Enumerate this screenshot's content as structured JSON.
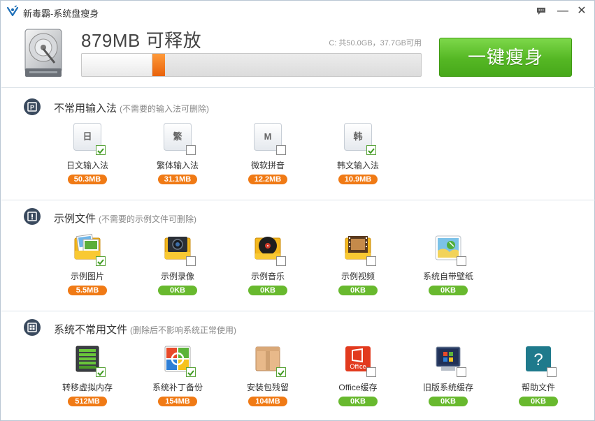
{
  "window": {
    "title": "新毒霸-系统盘瘦身"
  },
  "titlebar": {
    "feedback_icon": "chat-bubble-icon",
    "minimize_label": "—",
    "close_label": "✕"
  },
  "header": {
    "reclaim_text": "879MB 可释放",
    "disk_info": "C: 共50.0GB，37.7GB可用",
    "progress_used_fraction": 0.245,
    "slim_button_label": "一键瘦身",
    "accent_color": "#f07a15",
    "button_color": "#55b724"
  },
  "sections": [
    {
      "title": "不常用输入法",
      "hint": "(不需要的输入法可删除)",
      "items": [
        {
          "label": "日文输入法",
          "size": "50.3MB",
          "checked": true,
          "glyph": "日"
        },
        {
          "label": "繁体输入法",
          "size": "31.1MB",
          "checked": false,
          "glyph": "繁"
        },
        {
          "label": "微软拼音",
          "size": "12.2MB",
          "checked": false,
          "glyph": "M"
        },
        {
          "label": "韩文输入法",
          "size": "10.9MB",
          "checked": true,
          "glyph": "韩"
        }
      ]
    },
    {
      "title": "示例文件",
      "hint": "(不需要的示例文件可删除)",
      "items": [
        {
          "label": "示例图片",
          "size": "5.5MB",
          "checked": true
        },
        {
          "label": "示例录像",
          "size": "0KB",
          "checked": false
        },
        {
          "label": "示例音乐",
          "size": "0KB",
          "checked": false
        },
        {
          "label": "示例视频",
          "size": "0KB",
          "checked": false
        },
        {
          "label": "系统自带壁纸",
          "size": "0KB",
          "checked": false
        }
      ]
    },
    {
      "title": "系统不常用文件",
      "hint": "(删除后不影响系统正常使用)",
      "items": [
        {
          "label": "转移虚拟内存",
          "size": "512MB",
          "checked": true
        },
        {
          "label": "系统补丁备份",
          "size": "154MB",
          "checked": true
        },
        {
          "label": "安装包残留",
          "size": "104MB",
          "checked": true
        },
        {
          "label": "Office缓存",
          "size": "0KB",
          "checked": false,
          "glyph": "Office"
        },
        {
          "label": "旧版系统缓存",
          "size": "0KB",
          "checked": false
        },
        {
          "label": "帮助文件",
          "size": "0KB",
          "checked": false,
          "glyph": "?"
        }
      ]
    }
  ]
}
